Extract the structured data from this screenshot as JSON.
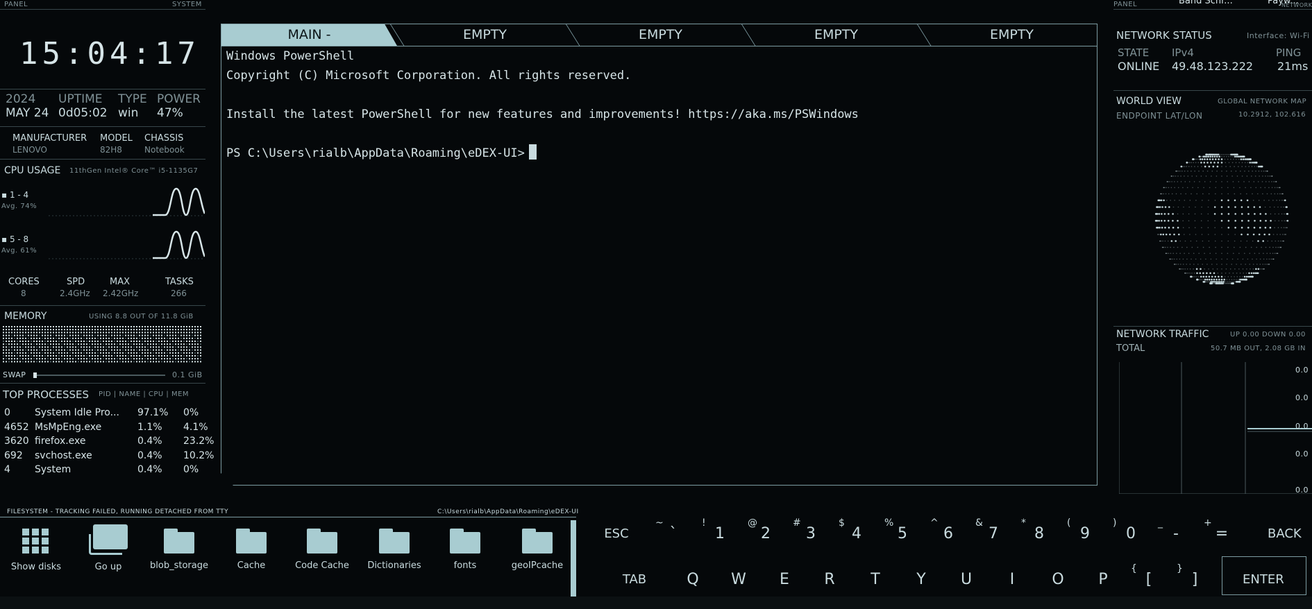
{
  "left": {
    "panel_label": "PANEL",
    "system_label": "SYSTEM",
    "clock": "15:04:17",
    "stats": [
      {
        "head": "2024",
        "val": "MAY 24"
      },
      {
        "head": "UPTIME",
        "val": "0d05:02"
      },
      {
        "head": "TYPE",
        "val": "win"
      },
      {
        "head": "POWER",
        "val": "47%"
      }
    ],
    "hw": [
      {
        "head": "MANUFACTURER",
        "val": "LENOVO"
      },
      {
        "head": "MODEL",
        "val": "82H8"
      },
      {
        "head": "CHASSIS",
        "val": "Notebook"
      }
    ],
    "cpu_title": "CPU USAGE",
    "cpu_model": "11thGen Intel® Core™ i5-1135G7",
    "cpu_groups": [
      {
        "name": "1 - 4",
        "avg": "Avg. 74%"
      },
      {
        "name": "5 - 8",
        "avg": "Avg. 61%"
      }
    ],
    "cpu_stats": [
      {
        "head": "CORES",
        "val": "8"
      },
      {
        "head": "SPD",
        "val": "2.4GHz"
      },
      {
        "head": "MAX",
        "val": "2.42GHz"
      },
      {
        "head": "TASKS",
        "val": "266"
      }
    ],
    "memory_title": "MEMORY",
    "memory_usage": "USING 8.8 OUT OF 11.8 GiB",
    "swap_label": "SWAP",
    "swap_value": "0.1 GiB",
    "proc_title": "TOP PROCESSES",
    "proc_cols": "PID | NAME | CPU | MEM",
    "processes": [
      {
        "pid": "0",
        "name": "System Idle Pro...",
        "cpu": "97.1%",
        "mem": "0%"
      },
      {
        "pid": "4652",
        "name": "MsMpEng.exe",
        "cpu": "1.1%",
        "mem": "4.1%"
      },
      {
        "pid": "3620",
        "name": "firefox.exe",
        "cpu": "0.4%",
        "mem": "23.2%"
      },
      {
        "pid": "692",
        "name": "svchost.exe",
        "cpu": "0.4%",
        "mem": "10.2%"
      },
      {
        "pid": "4",
        "name": "System",
        "cpu": "0.4%",
        "mem": "0%"
      }
    ]
  },
  "terminal": {
    "tabs": [
      "MAIN -",
      "EMPTY",
      "EMPTY",
      "EMPTY",
      "EMPTY"
    ],
    "lines": [
      "Windows PowerShell",
      "Copyright (C) Microsoft Corporation. All rights reserved.",
      "",
      "Install the latest PowerShell for new features and improvements! https://aka.ms/PSWindows",
      ""
    ],
    "prompt": "PS C:\\Users\\rialb\\AppData\\Roaming\\eDEX-UI>"
  },
  "right": {
    "panel_label": "PANEL",
    "top_labels": [
      "Band Schr...",
      "Payw..."
    ],
    "network_label": "NETWORK",
    "net_title": "NETWORK STATUS",
    "net_interface": "Interface: Wi-Fi",
    "net_state_head": "STATE",
    "net_state": "ONLINE",
    "net_ip_head": "IPv4",
    "net_ip": "49.48.123.222",
    "net_ping_head": "PING",
    "net_ping": "21ms",
    "world_title": "WORLD VIEW",
    "world_sub": "GLOBAL NETWORK MAP",
    "endpoint_label": "ENDPOINT LAT/LON",
    "endpoint_value": "10.2912, 102.616",
    "traffic_title": "NETWORK TRAFFIC",
    "traffic_rate": "UP 0.00 DOWN 0.00",
    "traffic_total_label": "TOTAL",
    "traffic_total": "50.7 MB OUT, 2.08 GB IN",
    "traffic_ticks": [
      "0.0",
      "0.0",
      "0.0",
      "0.0",
      "0.0"
    ]
  },
  "filesystem": {
    "title": "FILESYSTEM - TRACKING FAILED, RUNNING DETACHED FROM TTY",
    "path": "C:\\Users\\rialb\\AppData\\Roaming\\eDEX-UI",
    "items": [
      {
        "label": "Show disks",
        "icon": "grid-icon"
      },
      {
        "label": "Go up",
        "icon": "go-up-icon"
      },
      {
        "label": "blob_storage",
        "icon": "folder-icon"
      },
      {
        "label": "Cache",
        "icon": "folder-icon"
      },
      {
        "label": "Code Cache",
        "icon": "folder-icon"
      },
      {
        "label": "Dictionaries",
        "icon": "folder-icon"
      },
      {
        "label": "fonts",
        "icon": "folder-icon"
      },
      {
        "label": "geoIPcache",
        "icon": "folder-icon"
      }
    ]
  },
  "keyboard": {
    "row1": [
      {
        "main": "ESC",
        "alt": ""
      },
      {
        "main": "`",
        "alt": "~"
      },
      {
        "main": "1",
        "alt": "!"
      },
      {
        "main": "2",
        "alt": "@"
      },
      {
        "main": "3",
        "alt": "#"
      },
      {
        "main": "4",
        "alt": "$"
      },
      {
        "main": "5",
        "alt": "%"
      },
      {
        "main": "6",
        "alt": "^"
      },
      {
        "main": "7",
        "alt": "&"
      },
      {
        "main": "8",
        "alt": "*"
      },
      {
        "main": "9",
        "alt": "("
      },
      {
        "main": "0",
        "alt": ")"
      },
      {
        "main": "-",
        "alt": "_"
      },
      {
        "main": "=",
        "alt": "+"
      },
      {
        "main": "BACK",
        "alt": ""
      }
    ],
    "row2": [
      {
        "main": "TAB",
        "alt": ""
      },
      {
        "main": "Q",
        "alt": ""
      },
      {
        "main": "W",
        "alt": ""
      },
      {
        "main": "E",
        "alt": ""
      },
      {
        "main": "R",
        "alt": ""
      },
      {
        "main": "T",
        "alt": ""
      },
      {
        "main": "Y",
        "alt": ""
      },
      {
        "main": "U",
        "alt": ""
      },
      {
        "main": "I",
        "alt": ""
      },
      {
        "main": "O",
        "alt": ""
      },
      {
        "main": "P",
        "alt": ""
      },
      {
        "main": "[",
        "alt": "{"
      },
      {
        "main": "]",
        "alt": "}"
      },
      {
        "main": "ENTER",
        "alt": ""
      }
    ]
  }
}
